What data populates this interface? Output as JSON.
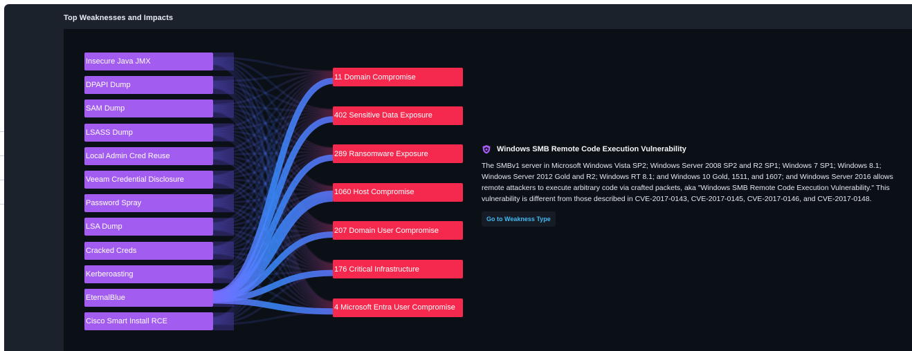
{
  "panel": {
    "title": "Top Weaknesses and Impacts"
  },
  "colors": {
    "panel_bg": "#1c222c",
    "content_bg": "#0b0f16",
    "source_node": "#a35cf0",
    "target_node": "#f5294e",
    "flow": "#4f6bff",
    "link": "#43b8f0"
  },
  "weaknesses": [
    "Insecure Java JMX",
    "DPAPI Dump",
    "SAM Dump",
    "LSASS Dump",
    "Local Admin Cred Reuse",
    "Veeam Credential Disclosure",
    "Password Spray",
    "LSA Dump",
    "Cracked Creds",
    "Kerberoasting",
    "EternalBlue",
    "Cisco Smart Install RCE"
  ],
  "impacts": [
    "11 Domain Compromise",
    "402 Sensitive Data Exposure",
    "289 Ransomware Exposure",
    "1060 Host Compromise",
    "207 Domain User Compromise",
    "176 Critical Infrastructure",
    "4 Microsoft Entra User Compromise"
  ],
  "highlighted_weakness": "EternalBlue",
  "detail": {
    "icon": "shield-icon",
    "title": "Windows SMB Remote Code Execution Vulnerability",
    "description": "The SMBv1 server in Microsoft Windows Vista SP2; Windows Server 2008 SP2 and R2 SP1; Windows 7 SP1; Windows 8.1; Windows Server 2012 Gold and R2; Windows RT 8.1; and Windows 10 Gold, 1511, and 1607; and Windows Server 2016 allows remote attackers to execute arbitrary code via crafted packets, aka \"Windows SMB Remote Code Execution Vulnerability.\" This vulnerability is different from those described in CVE-2017-0143, CVE-2017-0145, CVE-2017-0146, and CVE-2017-0148.",
    "button_label": "Go to Weakness Type"
  }
}
